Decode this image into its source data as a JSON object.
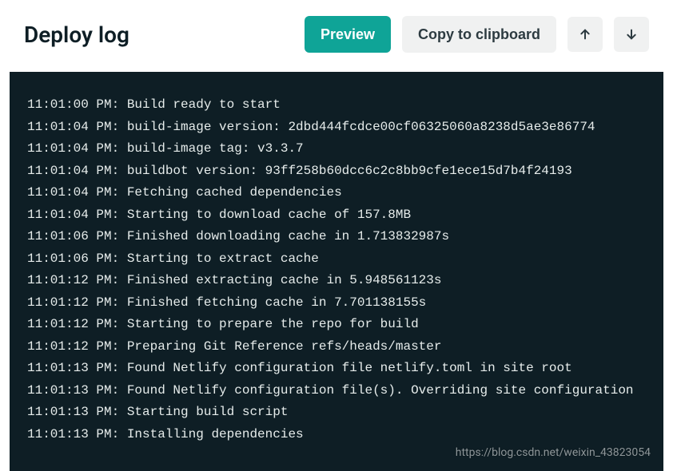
{
  "header": {
    "title": "Deploy log",
    "preview_label": "Preview",
    "copy_label": "Copy to clipboard"
  },
  "log": {
    "lines": [
      {
        "ts": "11:01:00 PM",
        "msg": "Build ready to start"
      },
      {
        "ts": "11:01:04 PM",
        "msg": "build-image version: 2dbd444fcdce00cf06325060a8238d5ae3e86774"
      },
      {
        "ts": "11:01:04 PM",
        "msg": "build-image tag: v3.3.7"
      },
      {
        "ts": "11:01:04 PM",
        "msg": "buildbot version: 93ff258b60dcc6c2c8bb9cfe1ece15d7b4f24193"
      },
      {
        "ts": "11:01:04 PM",
        "msg": "Fetching cached dependencies"
      },
      {
        "ts": "11:01:04 PM",
        "msg": "Starting to download cache of 157.8MB"
      },
      {
        "ts": "11:01:06 PM",
        "msg": "Finished downloading cache in 1.713832987s"
      },
      {
        "ts": "11:01:06 PM",
        "msg": "Starting to extract cache"
      },
      {
        "ts": "11:01:12 PM",
        "msg": "Finished extracting cache in 5.948561123s"
      },
      {
        "ts": "11:01:12 PM",
        "msg": "Finished fetching cache in 7.701138155s"
      },
      {
        "ts": "11:01:12 PM",
        "msg": "Starting to prepare the repo for build"
      },
      {
        "ts": "11:01:12 PM",
        "msg": "Preparing Git Reference refs/heads/master"
      },
      {
        "ts": "11:01:13 PM",
        "msg": "Found Netlify configuration file netlify.toml in site root"
      },
      {
        "ts": "11:01:13 PM",
        "msg": "Found Netlify configuration file(s). Overriding site configuration"
      },
      {
        "ts": "11:01:13 PM",
        "msg": "Starting build script"
      },
      {
        "ts": "11:01:13 PM",
        "msg": "Installing dependencies"
      }
    ]
  },
  "watermark": "https://blog.csdn.net/weixin_43823054"
}
